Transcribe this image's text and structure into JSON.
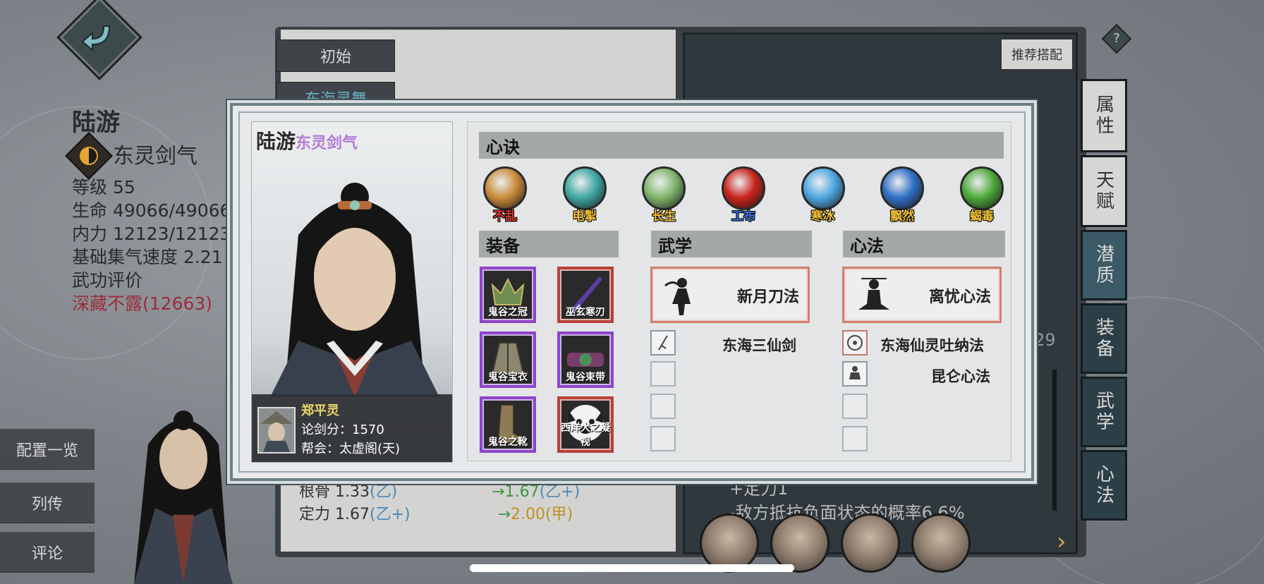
{
  "background": {
    "left_stats": {
      "name": "陆游",
      "skill": "东灵剑气",
      "level": "等级 55",
      "hp": "生命 49066/49066",
      "mp": "内力 12123/12123",
      "qi_speed": "基础集气速度 2.21",
      "rating_label": "武功评价",
      "rating": "深藏不露(12663)"
    },
    "left_menu": [
      "配置一览",
      "列传",
      "评论"
    ],
    "book_tabs": [
      "初始",
      "东海灵舞"
    ],
    "recommend_button": "推荐搭配",
    "help_icon": "?",
    "right_tabs": [
      "属性",
      "天赋",
      "潜质",
      "装备",
      "武学",
      "心法"
    ],
    "bottom_stats": [
      {
        "label": "根骨 1.33",
        "grade": "(乙)",
        "arrow": "→",
        "new": "1.67",
        "new_grade": "(乙+)"
      },
      {
        "label": "定力 1.67",
        "grade": "(乙+)",
        "arrow": "→",
        "new": "2.00",
        "new_grade": "(甲)"
      }
    ],
    "right_text": [
      "+定力1",
      "-敌方抵抗负面状态的概率6.6%"
    ],
    "right_count": "/29"
  },
  "dialog": {
    "char_name": "陆游",
    "char_style": "东灵剑气",
    "owner": {
      "name": "郑平灵",
      "score": "论剑分：1570",
      "guild": "帮会：太虚阁(天)"
    },
    "xinjue": {
      "title": "心诀",
      "tokens": [
        {
          "label": "不乱",
          "color": "#e0382c",
          "orb": "#c98a3a"
        },
        {
          "label": "电掣",
          "color": "#f2c233",
          "orb": "#3fa7a3"
        },
        {
          "label": "长生",
          "color": "#f2c233",
          "orb": "#7fb56c"
        },
        {
          "label": "工布",
          "color": "#3b6fd9",
          "orb": "#c9231d"
        },
        {
          "label": "寒冰",
          "color": "#f2c233",
          "orb": "#4da6e0"
        },
        {
          "label": "飘然",
          "color": "#f2c233",
          "orb": "#2f6fc4"
        },
        {
          "label": "蝎毒",
          "color": "#f2c233",
          "orb": "#4ea83a"
        }
      ]
    },
    "equipment": {
      "title": "装备",
      "items": [
        {
          "label": "鬼谷之冠",
          "frame": "purple"
        },
        {
          "label": "巫玄寒刃",
          "frame": "red"
        },
        {
          "label": "鬼谷宝衣",
          "frame": "purple"
        },
        {
          "label": "鬼谷束带",
          "frame": "purple"
        },
        {
          "label": "鬼谷之靴",
          "frame": "purple"
        },
        {
          "label": "西洋犬之凝视",
          "frame": "red"
        }
      ]
    },
    "wuxue": {
      "title": "武学",
      "main": "新月刀法",
      "slots": [
        "东海三仙剑",
        "",
        "",
        ""
      ]
    },
    "xinfa": {
      "title": "心法",
      "main": "离忧心法",
      "slots": [
        "东海仙灵吐纳法",
        "昆仑心法",
        "",
        ""
      ]
    }
  },
  "colors": {
    "purple_frame": "#8e45c8",
    "red_frame": "#b8413a",
    "name_accent": "#b37ad9",
    "rating_red": "#9c2c3c"
  }
}
